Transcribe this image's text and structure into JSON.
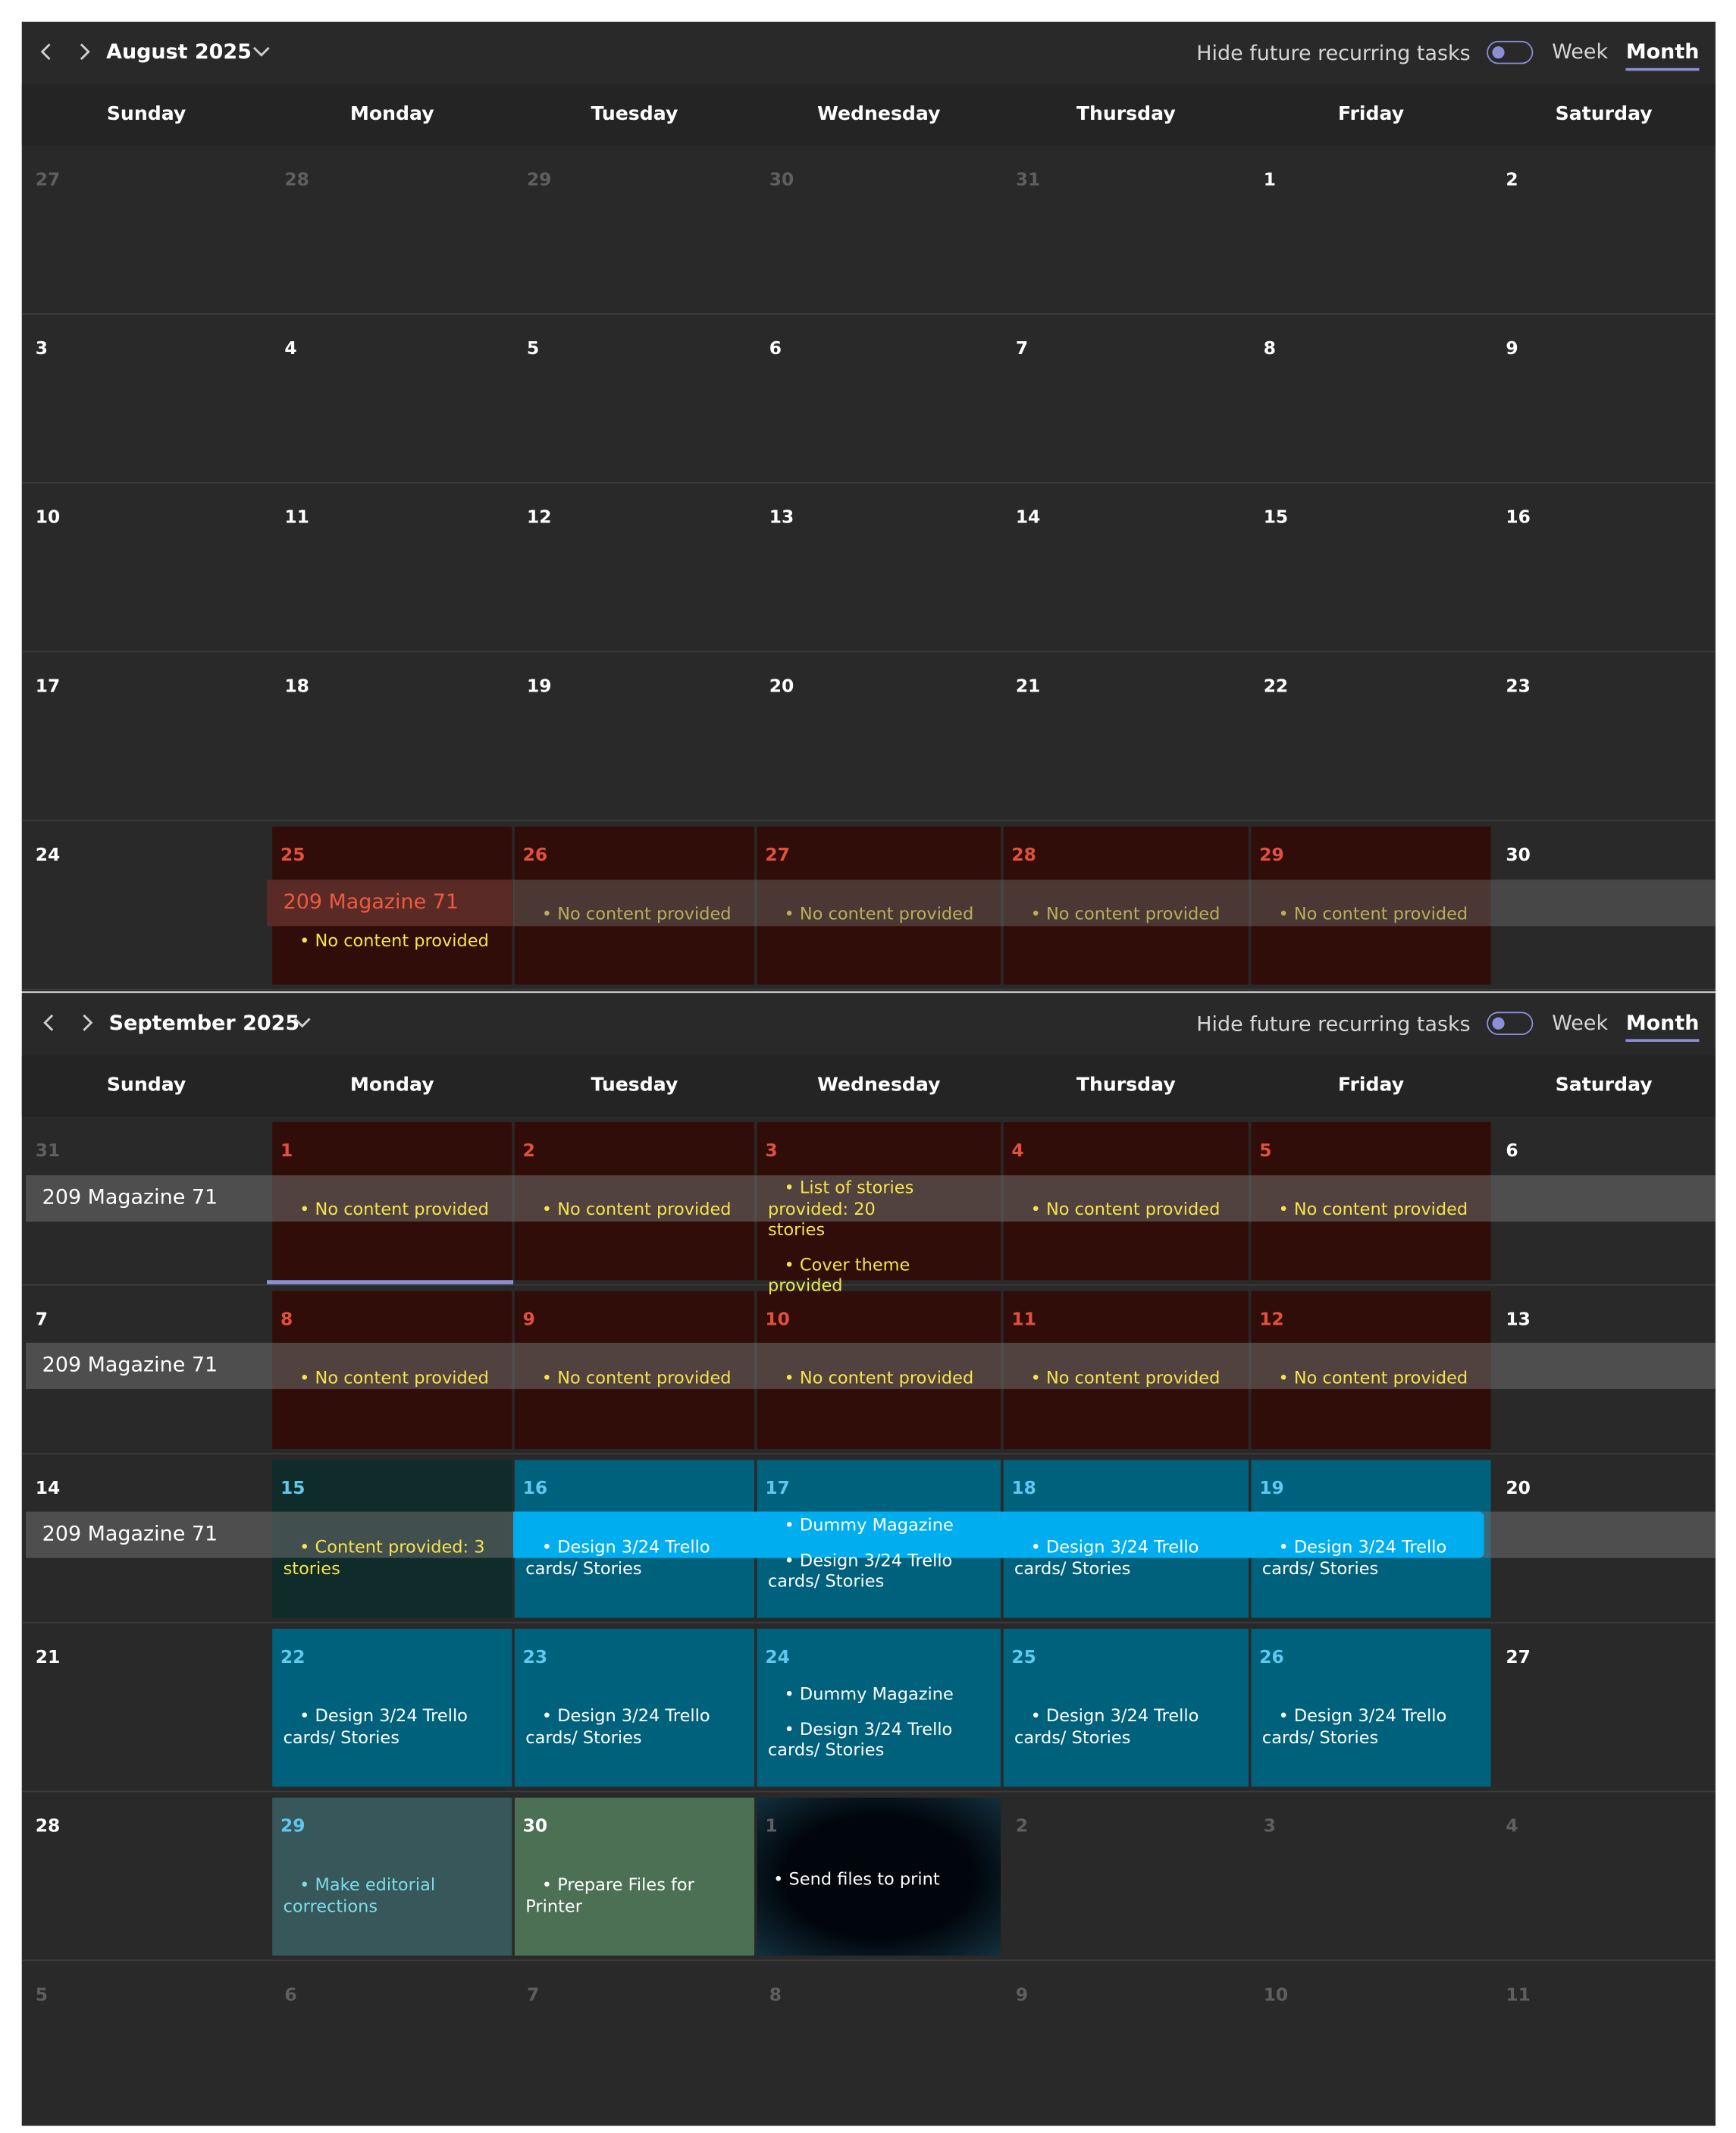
{
  "day_headers": [
    "Sunday",
    "Monday",
    "Tuesday",
    "Wednesday",
    "Thursday",
    "Friday",
    "Saturday"
  ],
  "colors": {
    "background": "#292929",
    "accent": "#8b8fd8",
    "highlight_red": "#300d08",
    "highlight_blue": "#00617d",
    "task_text_yellow": "#f5e44c",
    "band_gray": "#6d6d6d",
    "band_cyan": "#00aeef"
  },
  "icons": [
    "chevron-left-icon",
    "chevron-right-icon",
    "chevron-down-icon",
    "toggle-switch"
  ],
  "toolbar_labels": {
    "hide_recurring": "Hide future recurring tasks",
    "hide_recurring_on": false,
    "week": "Week",
    "month": "Month",
    "selected_view": "Month"
  },
  "calendars": [
    {
      "title": "August 2025",
      "weeks": [
        {
          "days": [
            {
              "num": "27",
              "muted": true
            },
            {
              "num": "28",
              "muted": true
            },
            {
              "num": "29",
              "muted": true
            },
            {
              "num": "30",
              "muted": true
            },
            {
              "num": "31",
              "muted": true
            },
            {
              "num": "1"
            },
            {
              "num": "2"
            }
          ]
        },
        {
          "days": [
            {
              "num": "3"
            },
            {
              "num": "4"
            },
            {
              "num": "5"
            },
            {
              "num": "6"
            },
            {
              "num": "7"
            },
            {
              "num": "8"
            },
            {
              "num": "9"
            }
          ]
        },
        {
          "days": [
            {
              "num": "10"
            },
            {
              "num": "11"
            },
            {
              "num": "12"
            },
            {
              "num": "13"
            },
            {
              "num": "14"
            },
            {
              "num": "15"
            },
            {
              "num": "16"
            }
          ]
        },
        {
          "days": [
            {
              "num": "17"
            },
            {
              "num": "18"
            },
            {
              "num": "19"
            },
            {
              "num": "20"
            },
            {
              "num": "21"
            },
            {
              "num": "22"
            },
            {
              "num": "23"
            }
          ]
        },
        {
          "band": {
            "name": "209 Magazine 71",
            "style": "red-start"
          },
          "days": [
            {
              "num": "24"
            },
            {
              "num": "25",
              "hl": "red",
              "tasks": [
                "No content provided"
              ]
            },
            {
              "num": "26",
              "hl": "red",
              "tasks": [
                "No content provided"
              ]
            },
            {
              "num": "27",
              "hl": "red",
              "tasks": [
                "No content provided"
              ]
            },
            {
              "num": "28",
              "hl": "red",
              "tasks": [
                "No content provided"
              ]
            },
            {
              "num": "29",
              "hl": "red",
              "tasks": [
                "No content provided"
              ]
            },
            {
              "num": "30"
            }
          ]
        }
      ]
    },
    {
      "title": "September 2025",
      "weeks": [
        {
          "band": {
            "name": "209 Magazine 71",
            "style": "gray"
          },
          "days": [
            {
              "num": "31",
              "muted": true
            },
            {
              "num": "1",
              "hl": "red",
              "tasks": [
                "No content provided"
              ]
            },
            {
              "num": "2",
              "hl": "red",
              "tasks": [
                "No content provided"
              ]
            },
            {
              "num": "3",
              "hl": "red",
              "tasks": [
                "List of stories provided: 20 stories",
                "Cover theme provided"
              ]
            },
            {
              "num": "4",
              "hl": "red",
              "tasks": [
                "No content provided"
              ]
            },
            {
              "num": "5",
              "hl": "red",
              "tasks": [
                "No content provided"
              ]
            },
            {
              "num": "6"
            }
          ]
        },
        {
          "band": {
            "name": "209 Magazine 71",
            "style": "gray"
          },
          "days": [
            {
              "num": "7"
            },
            {
              "num": "8",
              "hl": "red",
              "tasks": [
                "No content provided"
              ]
            },
            {
              "num": "9",
              "hl": "red",
              "tasks": [
                "No content provided"
              ]
            },
            {
              "num": "10",
              "hl": "red",
              "tasks": [
                "No content provided"
              ]
            },
            {
              "num": "11",
              "hl": "red",
              "tasks": [
                "No content provided"
              ]
            },
            {
              "num": "12",
              "hl": "red",
              "tasks": [
                "No content provided"
              ]
            },
            {
              "num": "13"
            }
          ]
        },
        {
          "band": {
            "name": "209 Magazine 71",
            "style": "gray-cyan"
          },
          "days": [
            {
              "num": "14"
            },
            {
              "num": "15",
              "hl": "teal",
              "tasks": [
                "Content provided: 3 stories"
              ]
            },
            {
              "num": "16",
              "hl": "blue",
              "tasks": [
                "Design 3/24 Trello cards/ Stories"
              ]
            },
            {
              "num": "17",
              "hl": "blue",
              "tasks": [
                "Dummy Magazine",
                "Design 3/24 Trello cards/ Stories"
              ]
            },
            {
              "num": "18",
              "hl": "blue",
              "tasks": [
                "Design 3/24 Trello cards/ Stories"
              ]
            },
            {
              "num": "19",
              "hl": "blue",
              "tasks": [
                "Design 3/24 Trello cards/ Stories"
              ]
            },
            {
              "num": "20"
            }
          ]
        },
        {
          "days": [
            {
              "num": "21"
            },
            {
              "num": "22",
              "hl": "blue",
              "tasks": [
                "Design 3/24 Trello cards/ Stories"
              ]
            },
            {
              "num": "23",
              "hl": "blue",
              "tasks": [
                "Design 3/24 Trello cards/ Stories"
              ]
            },
            {
              "num": "24",
              "hl": "blue",
              "tasks": [
                "Dummy Magazine",
                "Design 3/24 Trello cards/ Stories"
              ]
            },
            {
              "num": "25",
              "hl": "blue",
              "tasks": [
                "Design 3/24 Trello cards/ Stories"
              ]
            },
            {
              "num": "26",
              "hl": "blue",
              "tasks": [
                "Design 3/24 Trello cards/ Stories"
              ]
            },
            {
              "num": "27"
            }
          ]
        },
        {
          "days": [
            {
              "num": "28"
            },
            {
              "num": "29",
              "hl": "slate",
              "tasks": [
                "Make editorial corrections"
              ]
            },
            {
              "num": "30",
              "hl": "green",
              "tasks": [
                "Prepare Files for Printer"
              ]
            },
            {
              "num": "1",
              "hl": "dark",
              "muted": true,
              "tasks": [
                "Send files to print"
              ]
            },
            {
              "num": "2",
              "muted": true
            },
            {
              "num": "3",
              "muted": true
            },
            {
              "num": "4",
              "muted": true
            }
          ]
        },
        {
          "days": [
            {
              "num": "5",
              "muted": true
            },
            {
              "num": "6",
              "muted": true
            },
            {
              "num": "7",
              "muted": true
            },
            {
              "num": "8",
              "muted": true
            },
            {
              "num": "9",
              "muted": true
            },
            {
              "num": "10",
              "muted": true
            },
            {
              "num": "11",
              "muted": true
            }
          ]
        }
      ]
    }
  ]
}
